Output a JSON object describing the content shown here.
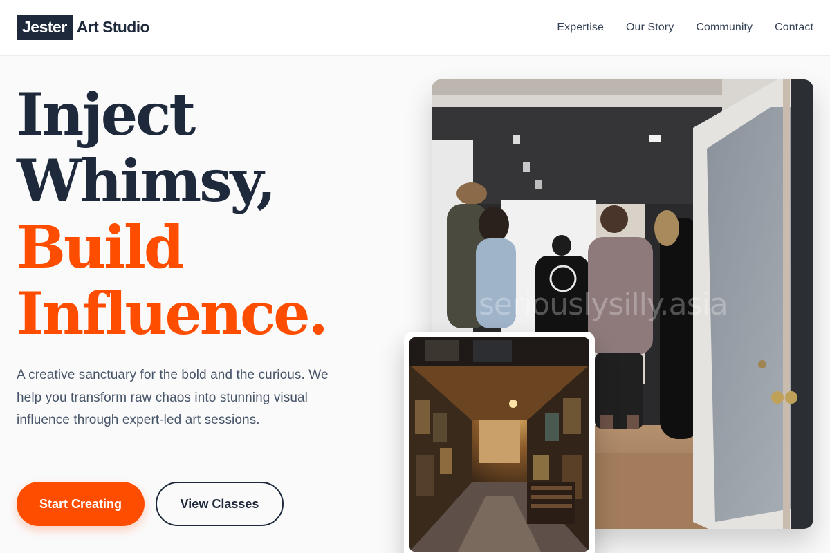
{
  "brand": {
    "box_text": "Jester",
    "text": "Art Studio"
  },
  "nav": [
    {
      "label": "Expertise"
    },
    {
      "label": "Our Story"
    },
    {
      "label": "Community"
    },
    {
      "label": "Contact"
    }
  ],
  "hero": {
    "headline": [
      "Inject",
      "Whimsy,",
      "Build",
      "Influence."
    ],
    "description": "A creative sanctuary for the bold and the curious. We help you transform raw chaos into stunning visual influence through expert-led art sessions.",
    "primary_button": "Start Creating",
    "secondary_button": "View Classes"
  },
  "images": {
    "main_watermark": "seriouslysilly.asia"
  },
  "colors": {
    "brand_dark": "#1e293b",
    "accent_orange": "#ff4d00",
    "body_text": "#475569"
  }
}
